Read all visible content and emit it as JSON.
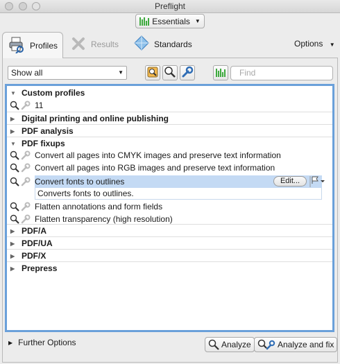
{
  "window": {
    "title": "Preflight"
  },
  "workspace": {
    "label": "Essentials"
  },
  "tabs": [
    {
      "label": "Profiles"
    },
    {
      "label": "Results"
    },
    {
      "label": "Standards"
    }
  ],
  "options_label": "Options",
  "filter": {
    "selected": "Show all"
  },
  "search": {
    "placeholder": "Find"
  },
  "tree": {
    "custom_profiles": "Custom profiles",
    "custom_item": "11",
    "digital_printing": "Digital printing and online publishing",
    "pdf_analysis": "PDF analysis",
    "pdf_fixups": "PDF fixups",
    "fixups": [
      "Convert all pages into CMYK images and preserve text information",
      "Convert all pages into RGB images and preserve text information",
      "Convert fonts to outlines",
      "Flatten annotations and form fields",
      "Flatten transparency (high resolution)"
    ],
    "selected_description": "Converts fonts to outlines.",
    "edit_label": "Edit...",
    "pdfa": "PDF/A",
    "pdfua": "PDF/UA",
    "pdfx": "PDF/X",
    "prepress": "Prepress"
  },
  "further_options": "Further Options",
  "analyze_label": "Analyze",
  "analyze_fix_label": "Analyze and fix",
  "colors": {
    "selection": "#c4daf4",
    "focus_ring": "#6aa0da",
    "bars": "#3eaa3e"
  }
}
